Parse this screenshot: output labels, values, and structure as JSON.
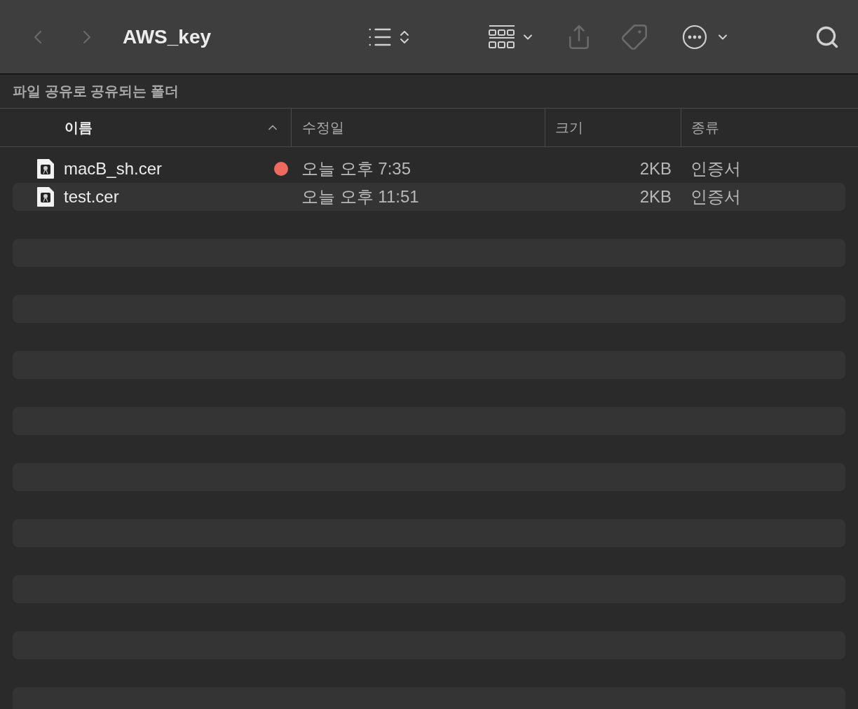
{
  "window": {
    "title": "AWS_key"
  },
  "toolbar": {
    "back_disabled": true,
    "forward_disabled": true
  },
  "path_bar": "파일 공유로 공유되는 폴더",
  "columns": [
    {
      "label": "이름",
      "sorted": true
    },
    {
      "label": "수정일",
      "sorted": false
    },
    {
      "label": "크기",
      "sorted": false
    },
    {
      "label": "종류",
      "sorted": false
    }
  ],
  "files": [
    {
      "name": "macB_sh.cer",
      "color": "#ec6a5e",
      "modified": "오늘 오후 7:35",
      "size": "2KB",
      "kind": "인증서"
    },
    {
      "name": "test.cer",
      "modified": "오늘 오후 11:51",
      "size": "2KB",
      "kind": "인증서"
    }
  ]
}
